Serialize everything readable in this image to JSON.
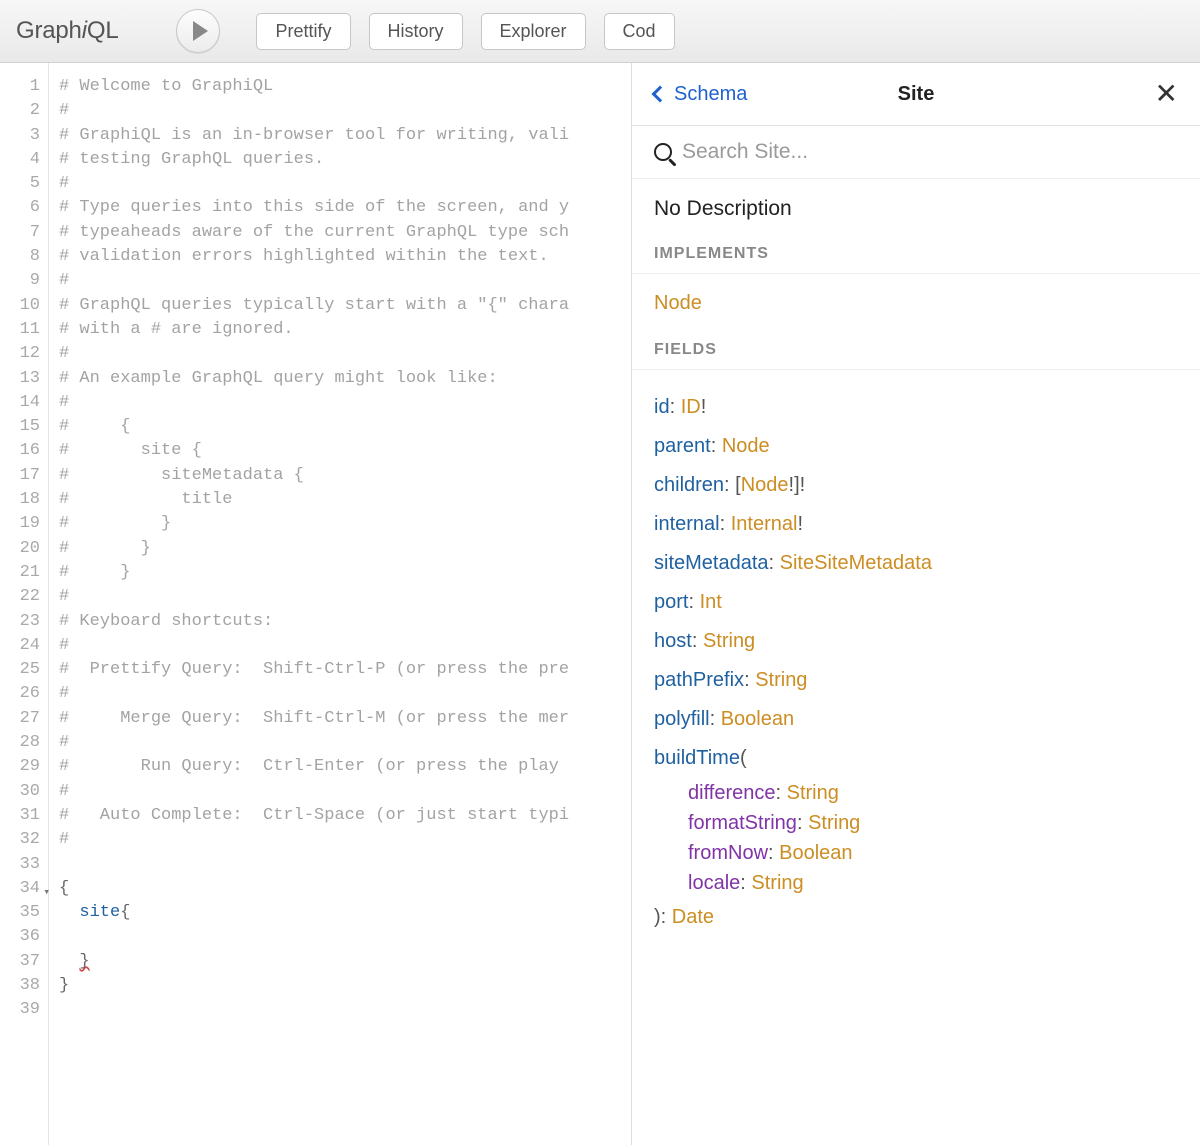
{
  "app": {
    "name": "GraphiQL"
  },
  "toolbar": {
    "prettify": "Prettify",
    "history": "History",
    "explorer": "Explorer",
    "code": "Cod"
  },
  "editor": {
    "lines": [
      {
        "n": 1,
        "type": "comment",
        "text": "# Welcome to GraphiQL"
      },
      {
        "n": 2,
        "type": "comment",
        "text": "#"
      },
      {
        "n": 3,
        "type": "comment",
        "text": "# GraphiQL is an in-browser tool for writing, vali"
      },
      {
        "n": 4,
        "type": "comment",
        "text": "# testing GraphQL queries."
      },
      {
        "n": 5,
        "type": "comment",
        "text": "#"
      },
      {
        "n": 6,
        "type": "comment",
        "text": "# Type queries into this side of the screen, and y"
      },
      {
        "n": 7,
        "type": "comment",
        "text": "# typeaheads aware of the current GraphQL type sch"
      },
      {
        "n": 8,
        "type": "comment",
        "text": "# validation errors highlighted within the text."
      },
      {
        "n": 9,
        "type": "comment",
        "text": "#"
      },
      {
        "n": 10,
        "type": "comment",
        "text": "# GraphQL queries typically start with a \"{\" chara"
      },
      {
        "n": 11,
        "type": "comment",
        "text": "# with a # are ignored."
      },
      {
        "n": 12,
        "type": "comment",
        "text": "#"
      },
      {
        "n": 13,
        "type": "comment",
        "text": "# An example GraphQL query might look like:"
      },
      {
        "n": 14,
        "type": "comment",
        "text": "#"
      },
      {
        "n": 15,
        "type": "comment",
        "text": "#     {"
      },
      {
        "n": 16,
        "type": "comment",
        "text": "#       site {"
      },
      {
        "n": 17,
        "type": "comment",
        "text": "#         siteMetadata {"
      },
      {
        "n": 18,
        "type": "comment",
        "text": "#           title"
      },
      {
        "n": 19,
        "type": "comment",
        "text": "#         }"
      },
      {
        "n": 20,
        "type": "comment",
        "text": "#       }"
      },
      {
        "n": 21,
        "type": "comment",
        "text": "#     }"
      },
      {
        "n": 22,
        "type": "comment",
        "text": "#"
      },
      {
        "n": 23,
        "type": "comment",
        "text": "# Keyboard shortcuts:"
      },
      {
        "n": 24,
        "type": "comment",
        "text": "#"
      },
      {
        "n": 25,
        "type": "comment",
        "text": "#  Prettify Query:  Shift-Ctrl-P (or press the pre"
      },
      {
        "n": 26,
        "type": "comment",
        "text": "#"
      },
      {
        "n": 27,
        "type": "comment",
        "text": "#     Merge Query:  Shift-Ctrl-M (or press the mer"
      },
      {
        "n": 28,
        "type": "comment",
        "text": "#"
      },
      {
        "n": 29,
        "type": "comment",
        "text": "#       Run Query:  Ctrl-Enter (or press the play "
      },
      {
        "n": 30,
        "type": "comment",
        "text": "#"
      },
      {
        "n": 31,
        "type": "comment",
        "text": "#   Auto Complete:  Ctrl-Space (or just start typi"
      },
      {
        "n": 32,
        "type": "comment",
        "text": "#"
      },
      {
        "n": 33,
        "type": "blank",
        "text": ""
      },
      {
        "n": 34,
        "type": "punct",
        "text": "{",
        "fold": true
      },
      {
        "n": 35,
        "type": "site",
        "text": ""
      },
      {
        "n": 36,
        "type": "blank",
        "text": "    "
      },
      {
        "n": 37,
        "type": "close-err",
        "text": "  }"
      },
      {
        "n": 38,
        "type": "punct",
        "text": "}"
      },
      {
        "n": 39,
        "type": "blank",
        "text": ""
      }
    ]
  },
  "docs": {
    "back_label": "Schema",
    "title": "Site",
    "search_placeholder": "Search Site...",
    "description": "No Description",
    "implements_header": "IMPLEMENTS",
    "implements": [
      "Node"
    ],
    "fields_header": "FIELDS",
    "fields": [
      {
        "name": "id",
        "type": "ID",
        "nonnull": true
      },
      {
        "name": "parent",
        "type": "Node"
      },
      {
        "name": "children",
        "type": "Node",
        "list": true,
        "item_nonnull": true,
        "nonnull": true
      },
      {
        "name": "internal",
        "type": "Internal",
        "nonnull": true
      },
      {
        "name": "siteMetadata",
        "type": "SiteSiteMetadata"
      },
      {
        "name": "port",
        "type": "Int"
      },
      {
        "name": "host",
        "type": "String"
      },
      {
        "name": "pathPrefix",
        "type": "String"
      },
      {
        "name": "polyfill",
        "type": "Boolean"
      },
      {
        "name": "buildTime",
        "type": "Date",
        "args": [
          {
            "name": "difference",
            "type": "String"
          },
          {
            "name": "formatString",
            "type": "String"
          },
          {
            "name": "fromNow",
            "type": "Boolean"
          },
          {
            "name": "locale",
            "type": "String"
          }
        ]
      }
    ]
  }
}
